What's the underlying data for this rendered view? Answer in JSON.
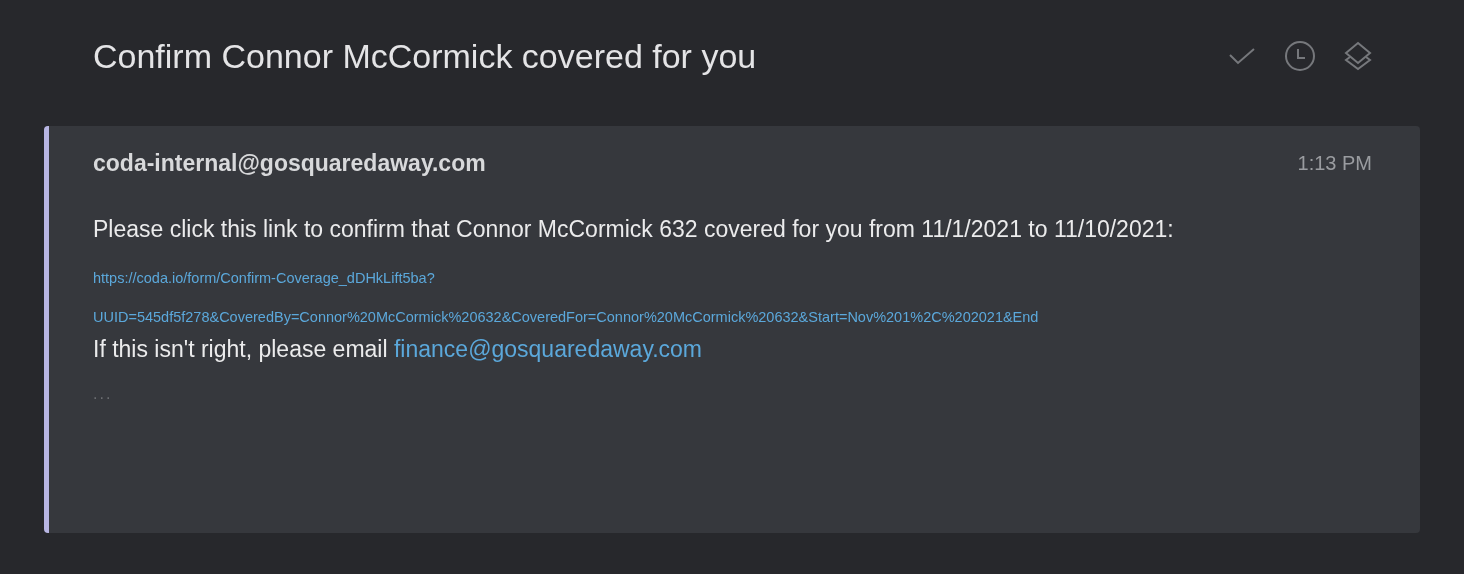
{
  "thread": {
    "subject": "Confirm Connor McCormick covered for you",
    "actions": [
      {
        "kind": "done"
      },
      {
        "kind": "snooze"
      },
      {
        "kind": "archive"
      }
    ]
  },
  "message": {
    "sender": "coda-internal@gosquaredaway.com",
    "time": "1:13 PM",
    "body": "Please click this link to confirm that Connor McCormick 632 covered for you from 11/1/2021 to 11/10/2021:",
    "link_lines": [
      "https://coda.io/form/Confirm-Coverage_dDHkLift5ba?",
      "UUID=545df5f278&CoveredBy=Connor%20McCormick%20632&CoveredFor=Connor%20McCormick%20632&Start=Nov%201%2C%202021&End"
    ],
    "footer": "If this isn't right, please email",
    "footer_link": "finance@gosquaredaway.com",
    "more": "..."
  }
}
